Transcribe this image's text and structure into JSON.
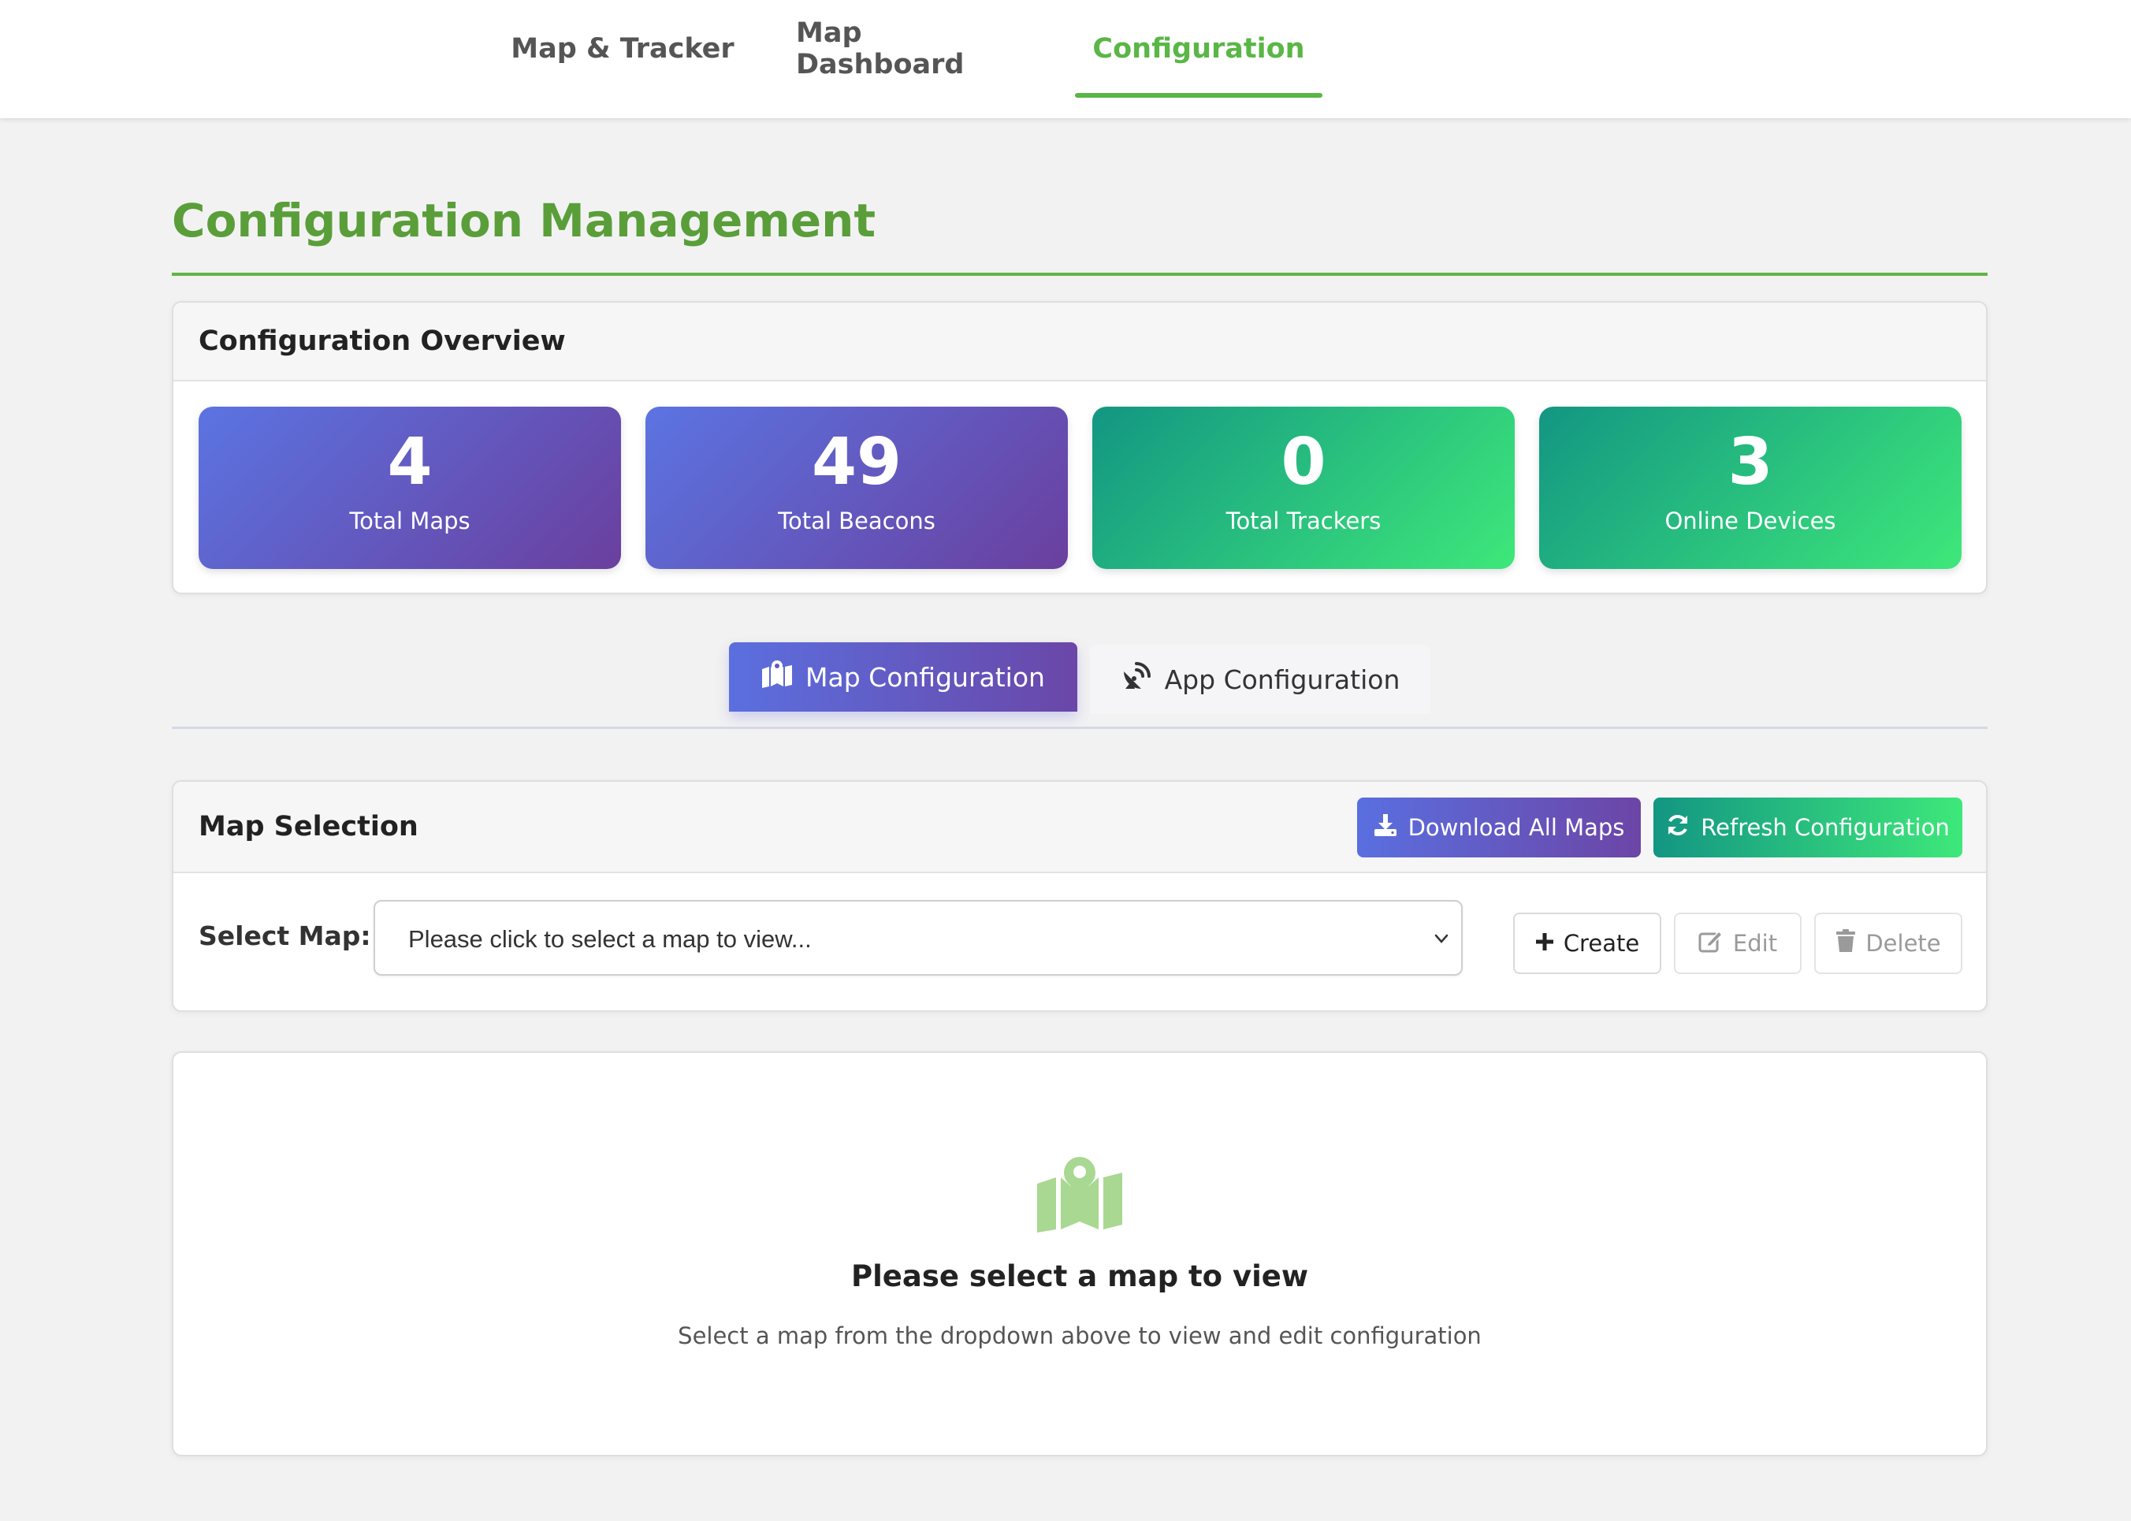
{
  "nav": {
    "tabs": [
      {
        "label": "Map & Tracker"
      },
      {
        "label": "Map Dashboard"
      },
      {
        "label": "Configuration"
      }
    ],
    "active_color": "#5ab646"
  },
  "page": {
    "title": "Configuration Management"
  },
  "overview": {
    "title": "Configuration Overview",
    "stats": [
      {
        "value": "4",
        "label": "Total Maps"
      },
      {
        "value": "49",
        "label": "Total Beacons"
      },
      {
        "value": "0",
        "label": "Total Trackers"
      },
      {
        "value": "3",
        "label": "Online Devices"
      }
    ]
  },
  "subtabs": {
    "map": {
      "label": "Map Configuration",
      "icon": "map-marked-icon"
    },
    "app": {
      "label": "App Configuration",
      "icon": "satellite-dish-icon"
    }
  },
  "selection": {
    "title": "Map Selection",
    "download_label": "Download All Maps",
    "refresh_label": "Refresh Configuration",
    "select_label": "Select Map:",
    "select_value": "Please click to select a map to view...",
    "create_label": "Create",
    "edit_label": "Edit",
    "delete_label": "Delete"
  },
  "empty": {
    "title": "Please select a map to view",
    "description": "Select a map from the dropdown above to view and edit configuration"
  },
  "colors": {
    "brand_green": "#5a9e3a",
    "purple_start": "#5b74e2",
    "purple_end": "#6a3f9e",
    "teal_start": "#139683",
    "teal_end": "#3ee87a"
  }
}
